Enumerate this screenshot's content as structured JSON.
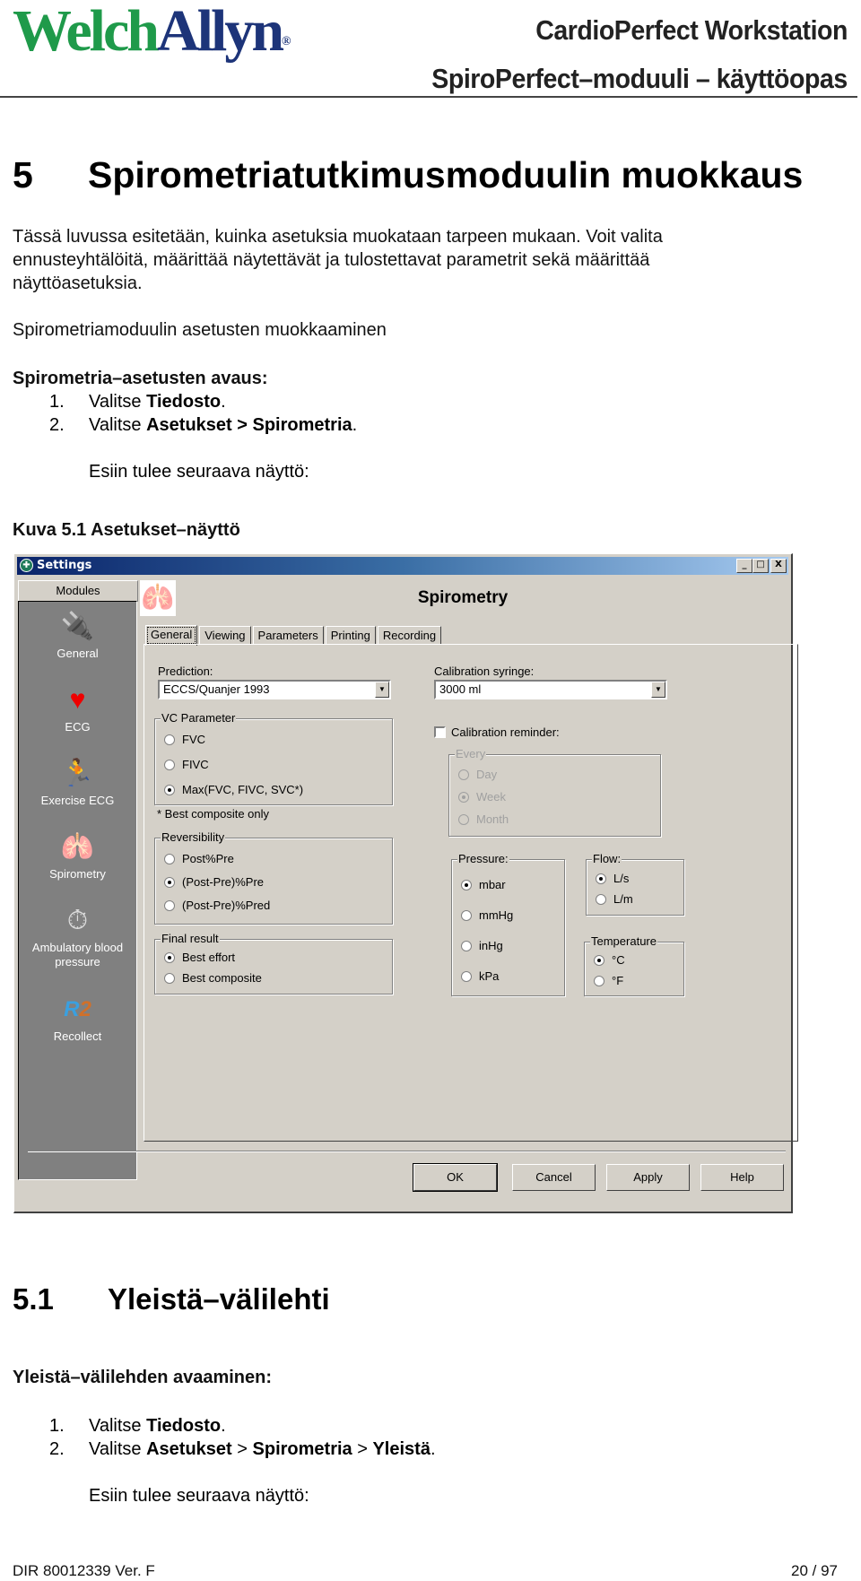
{
  "header": {
    "logo_part1": "Welch",
    "logo_part2": "Allyn",
    "logo_reg": "®",
    "product": "CardioPerfect Workstation",
    "manual": "SpiroPerfect–moduuli – käyttöopas"
  },
  "chapter": {
    "number": "5",
    "title": "Spirometriatutkimusmoduulin muokkaus",
    "intro_line1": "Tässä luvussa esitetään, kuinka asetuksia muokataan tarpeen mukaan. Voit valita",
    "intro_line2": "ennusteyhtälöitä, määrittää näytettävät ja tulostettavat parametrit sekä määrittää",
    "intro_line3": "näyttöasetuksia.",
    "subtitle": "Spirometriamoduulin asetusten muokkaaminen",
    "procedure_heading": "Spirometria–asetusten avaus:",
    "steps": [
      {
        "num": "1.",
        "prefix": "Valitse ",
        "bold": "Tiedosto",
        "suffix": "."
      },
      {
        "num": "2.",
        "prefix": "Valitse ",
        "bold": "Asetukset > Spirometria",
        "suffix": "."
      }
    ],
    "result_text": "Esiin tulee seuraava näyttö:",
    "figure_caption": "Kuva 5.1 Asetukset–näyttö"
  },
  "dialog": {
    "title": "Settings",
    "window_buttons": {
      "minimize": "_",
      "maximize": "□",
      "close": "X"
    },
    "sidebar_header": "Modules",
    "modules": [
      {
        "label": "General",
        "icon": "🔌"
      },
      {
        "label": "ECG",
        "icon": "♥"
      },
      {
        "label": "Exercise ECG",
        "icon": "🏃"
      },
      {
        "label": "Spirometry",
        "icon": "🫁"
      },
      {
        "label": "Ambulatory blood pressure",
        "icon": "⏱"
      },
      {
        "label": "Recollect",
        "icon": "R2"
      }
    ],
    "page_title": "Spirometry",
    "tabs": [
      "General",
      "Viewing",
      "Parameters",
      "Printing",
      "Recording"
    ],
    "active_tab": "General",
    "prediction": {
      "label": "Prediction:",
      "value": "ECCS/Quanjer 1993"
    },
    "calibration_syringe": {
      "label": "Calibration syringe:",
      "value": "3000 ml"
    },
    "vc_parameter": {
      "legend": "VC Parameter",
      "options": [
        "FVC",
        "FIVC",
        "Max(FVC, FIVC, SVC*)"
      ],
      "selected": 2,
      "note": "* Best composite only"
    },
    "calibration_reminder": {
      "label": "Calibration reminder:",
      "checked": false
    },
    "every": {
      "legend": "Every",
      "options": [
        "Day",
        "Week",
        "Month"
      ],
      "selected": 1,
      "disabled": true
    },
    "reversibility": {
      "legend": "Reversibility",
      "options": [
        "Post%Pre",
        "(Post-Pre)%Pre",
        "(Post-Pre)%Pred"
      ],
      "selected": 1
    },
    "final_result": {
      "legend": "Final result",
      "options": [
        "Best effort",
        "Best composite"
      ],
      "selected": 0
    },
    "pressure": {
      "legend": "Pressure:",
      "options": [
        "mbar",
        "mmHg",
        "inHg",
        "kPa"
      ],
      "selected": 0
    },
    "flow": {
      "legend": "Flow:",
      "options": [
        "L/s",
        "L/m"
      ],
      "selected": 0
    },
    "temperature": {
      "legend": "Temperature",
      "options": [
        "°C",
        "°F"
      ],
      "selected": 0
    },
    "buttons": {
      "ok": "OK",
      "cancel": "Cancel",
      "apply": "Apply",
      "help": "Help"
    }
  },
  "section": {
    "number": "5.1",
    "title": "Yleistä–välilehti",
    "procedure_heading": "Yleistä–välilehden avaaminen:",
    "step1": {
      "num": "1.",
      "prefix": "Valitse ",
      "bold": "Tiedosto",
      "suffix": "."
    },
    "step2": {
      "num": "2.",
      "prefix": "Valitse ",
      "b1": "Asetukset",
      "sep1": " > ",
      "b2": "Spirometria",
      "sep2": " > ",
      "b3": "Yleistä",
      "suffix": "."
    },
    "result_text": "Esiin tulee seuraava näyttö:"
  },
  "footer": {
    "doc_id": "DIR 80012339 Ver. F",
    "page": "20 / 97"
  }
}
